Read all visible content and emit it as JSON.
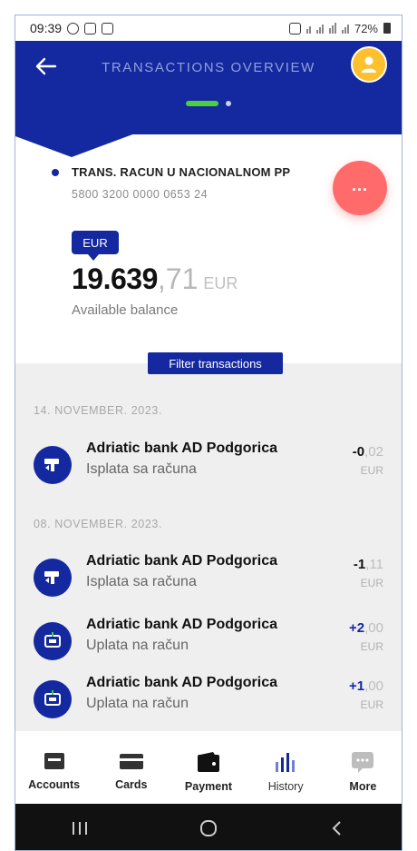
{
  "status_bar": {
    "time": "09:39",
    "battery": "72%"
  },
  "header": {
    "title": "TRANSACTIONS OVERVIEW",
    "accent": "#1428a0",
    "avatar_color": "#ffc02e"
  },
  "account": {
    "name": "TRANS. RACUN U NACIONALNOM PP",
    "number": "5800 3200 0000 0653 24",
    "currency_badge": "EUR",
    "balance_int": "19.639",
    "balance_dec": ",71",
    "balance_currency": "EUR",
    "balance_label": "Available balance"
  },
  "fab": {
    "label": "...",
    "color": "#ff6b6b"
  },
  "filter": {
    "label": "Filter transactions"
  },
  "groups": [
    {
      "date": "14. NOVEMBER. 2023.",
      "items": [
        {
          "name": "Adriatic bank AD Podgorica",
          "desc": "Isplata sa računa",
          "amount_int": "-0",
          "amount_dec": ",02",
          "currency": "EUR",
          "icon": "withdrawal-icon"
        }
      ]
    },
    {
      "date": "08. NOVEMBER. 2023.",
      "items": [
        {
          "name": "Adriatic bank AD Podgorica",
          "desc": "Isplata sa računa",
          "amount_int": "-1",
          "amount_dec": ",11",
          "currency": "EUR",
          "icon": "withdrawal-icon"
        },
        {
          "name": "Adriatic bank AD Podgorica",
          "desc": "Uplata na račun",
          "amount_int": "+2",
          "amount_dec": ",00",
          "currency": "EUR",
          "icon": "deposit-icon"
        },
        {
          "name": "Adriatic bank AD Podgorica",
          "desc": "Uplata na račun",
          "amount_int": "+1",
          "amount_dec": ",00",
          "currency": "EUR",
          "icon": "deposit-icon"
        }
      ]
    }
  ],
  "bottom_nav": [
    {
      "label": "Accounts",
      "icon": "accounts-icon"
    },
    {
      "label": "Cards",
      "icon": "card-icon"
    },
    {
      "label": "Payment",
      "icon": "wallet-icon"
    },
    {
      "label": "History",
      "icon": "bar-chart-icon",
      "active": true
    },
    {
      "label": "More",
      "icon": "more-icon"
    }
  ]
}
